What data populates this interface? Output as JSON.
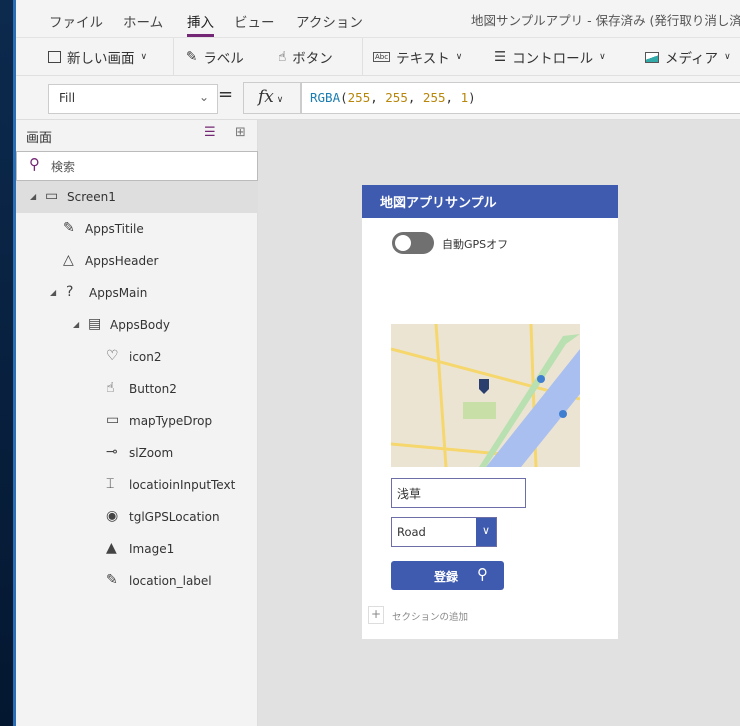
{
  "menu": {
    "items": [
      "ファイル",
      "ホーム",
      "挿入",
      "ビュー",
      "アクション"
    ],
    "active": "挿入"
  },
  "window_title": "地図サンプルアプリ - 保存済み (発行取り消し済み",
  "toolbar": {
    "new_screen": "新しい画面",
    "label": "ラベル",
    "button": "ボタン",
    "text": "テキスト",
    "controls": "コントロール",
    "media": "メディア"
  },
  "formula": {
    "property": "Fill",
    "equals": "=",
    "fx": "fx",
    "fn": "RGBA",
    "args": [
      "255",
      "255",
      "255",
      "1"
    ]
  },
  "tree": {
    "header": "画面",
    "search_placeholder": "検索",
    "items": [
      {
        "label": "Screen1",
        "icon": "screen-icon"
      },
      {
        "label": "AppsTitile",
        "icon": "label-icon"
      },
      {
        "label": "AppsHeader",
        "icon": "shapes-icon"
      },
      {
        "label": "AppsMain",
        "icon": "unknown-icon"
      },
      {
        "label": "AppsBody",
        "icon": "form-icon"
      },
      {
        "label": "icon2",
        "icon": "icons-icon"
      },
      {
        "label": "Button2",
        "icon": "button-icon"
      },
      {
        "label": "mapTypeDrop",
        "icon": "dropdown-icon"
      },
      {
        "label": "slZoom",
        "icon": "slider-icon"
      },
      {
        "label": "locatioinInputText",
        "icon": "text-input-icon"
      },
      {
        "label": "tglGPSLocation",
        "icon": "toggle-icon"
      },
      {
        "label": "Image1",
        "icon": "image-icon"
      },
      {
        "label": "location_label",
        "icon": "label-icon"
      }
    ]
  },
  "app": {
    "title": "地図アプリサンプル",
    "toggle_label": "自動GPSオフ",
    "toggle_on": false,
    "location_value": "浅草",
    "map_type": "Road",
    "register_label": "登録",
    "add_section": "セクションの追加",
    "accent": "#3f5bb0"
  }
}
